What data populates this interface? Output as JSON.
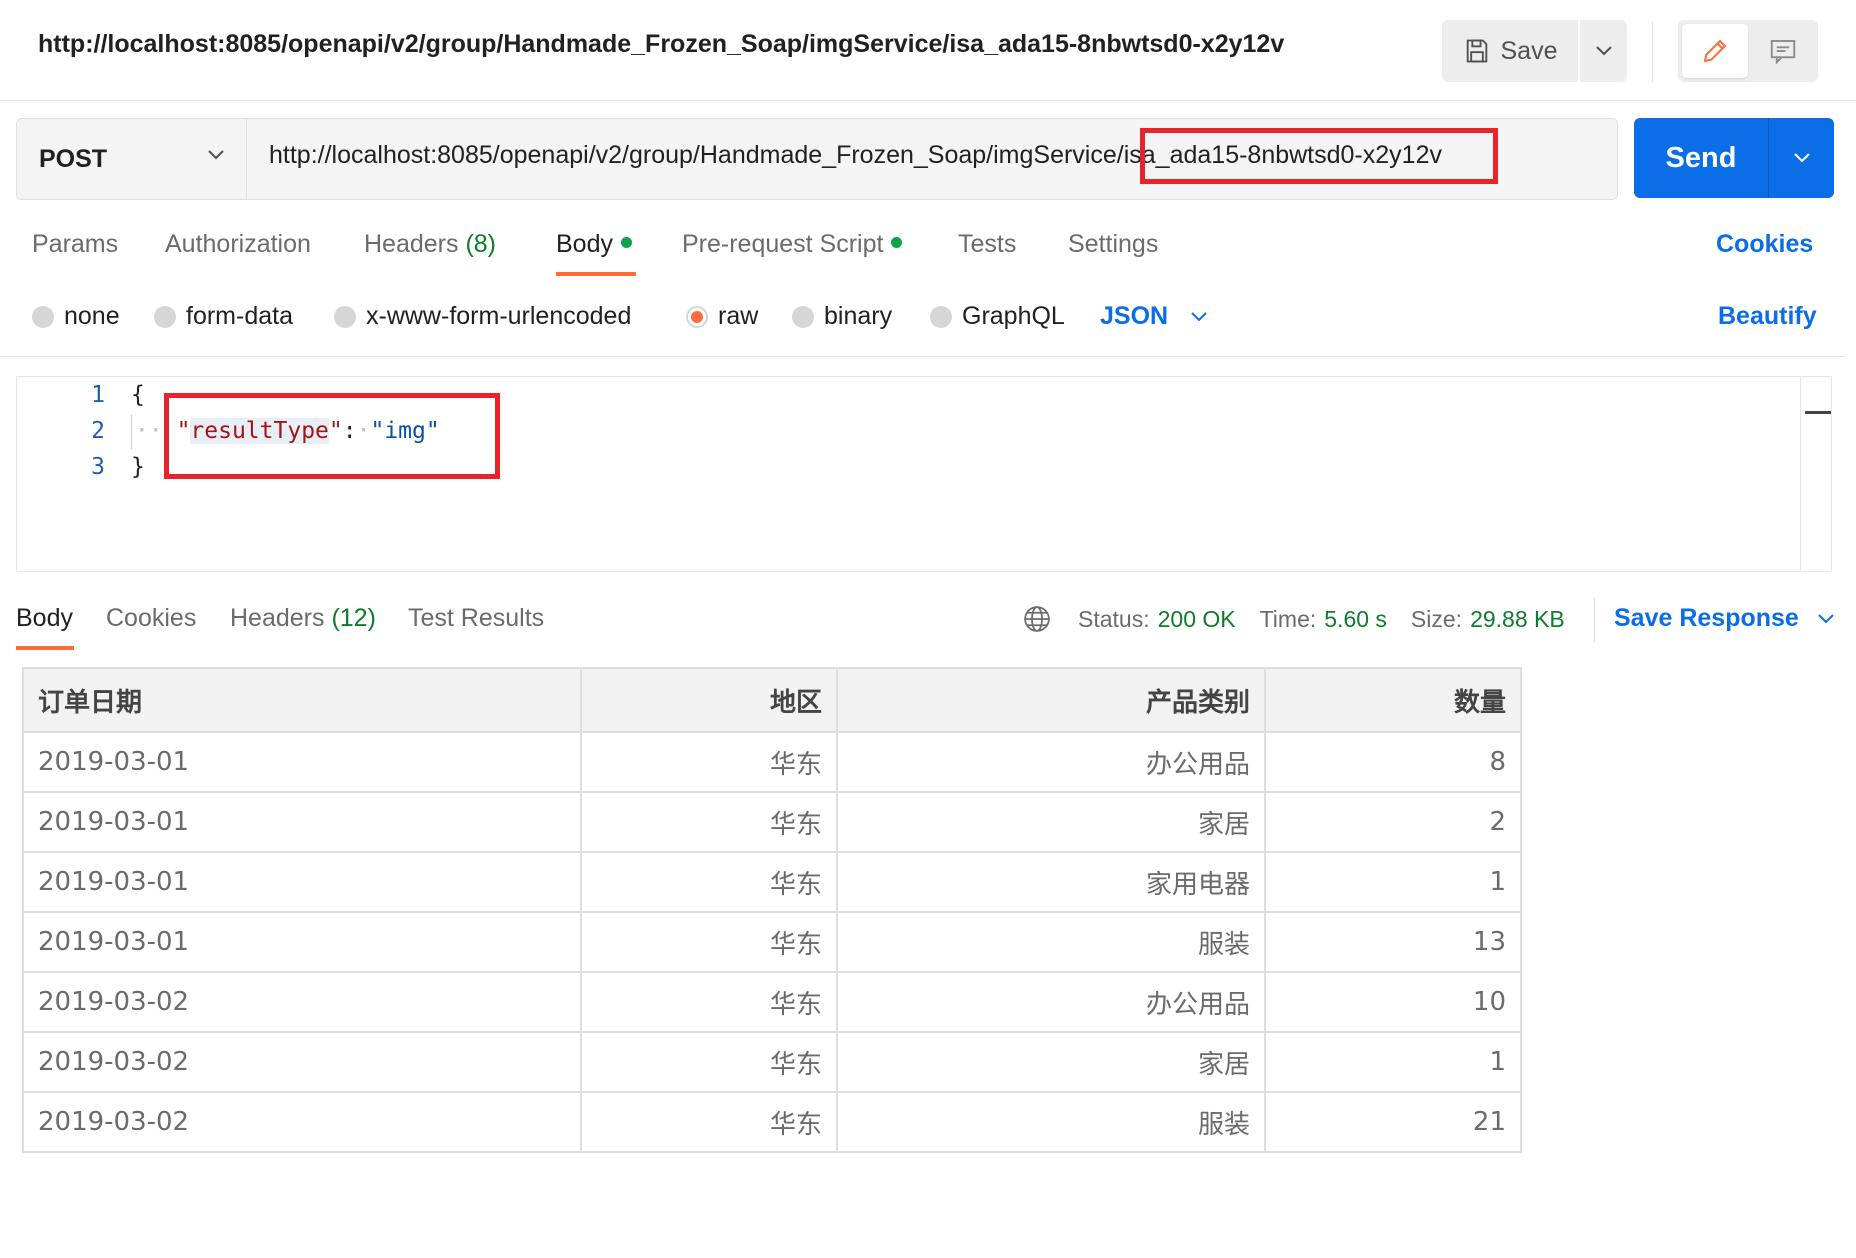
{
  "header": {
    "title": "http://localhost:8085/openapi/v2/group/Handmade_Frozen_Soap/imgService/isa_ada15-8nbwtsd0-x2y12v",
    "save_label": "Save"
  },
  "request": {
    "method": "POST",
    "url": "http://localhost:8085/openapi/v2/group/Handmade_Frozen_Soap/imgService/isa_ada15-8nbwtsd0-x2y12v",
    "send_label": "Send"
  },
  "request_tabs": {
    "params": "Params",
    "authorization": "Authorization",
    "headers": "Headers",
    "headers_count": "(8)",
    "body": "Body",
    "prerequest": "Pre-request Script",
    "tests": "Tests",
    "settings": "Settings",
    "cookies": "Cookies"
  },
  "body_types": {
    "none": "none",
    "form_data": "form-data",
    "urlencoded": "x-www-form-urlencoded",
    "raw": "raw",
    "binary": "binary",
    "graphql": "GraphQL",
    "selected": "raw",
    "format": "JSON",
    "beautify": "Beautify"
  },
  "editor": {
    "line_numbers": [
      "1",
      "2",
      "3"
    ],
    "open_brace": "{",
    "close_brace": "}",
    "key": "resultType",
    "value": "\"img\""
  },
  "response_tabs": {
    "body": "Body",
    "cookies": "Cookies",
    "headers": "Headers",
    "headers_count": "(12)",
    "test_results": "Test Results"
  },
  "response_status": {
    "status_label": "Status:",
    "status_value": "200 OK",
    "time_label": "Time:",
    "time_value": "5.60 s",
    "size_label": "Size:",
    "size_value": "29.88 KB",
    "save_response": "Save Response"
  },
  "result_table": {
    "headers": [
      "订单日期",
      "地区",
      "产品类别",
      "数量"
    ],
    "rows": [
      [
        "2019-03-01",
        "华东",
        "办公用品",
        "8"
      ],
      [
        "2019-03-01",
        "华东",
        "家居",
        "2"
      ],
      [
        "2019-03-01",
        "华东",
        "家用电器",
        "1"
      ],
      [
        "2019-03-01",
        "华东",
        "服装",
        "13"
      ],
      [
        "2019-03-02",
        "华东",
        "办公用品",
        "10"
      ],
      [
        "2019-03-02",
        "华东",
        "家居",
        "1"
      ],
      [
        "2019-03-02",
        "华东",
        "服装",
        "21"
      ]
    ]
  },
  "colors": {
    "accent_blue": "#0b6ee6",
    "active_tab": "#ff6c37",
    "success_green": "#0f7b2d",
    "annotation_red": "#e8232a"
  }
}
